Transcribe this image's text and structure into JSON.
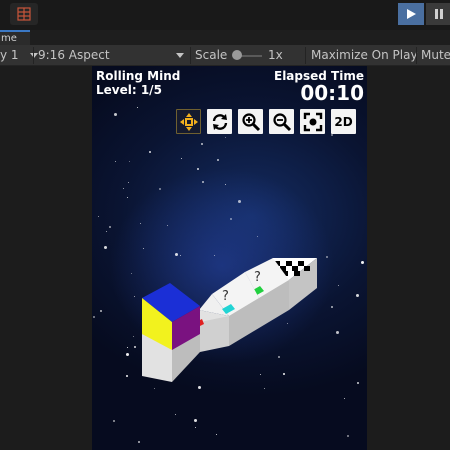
{
  "editor": {
    "tab_label": "me",
    "display_label": "y 1",
    "aspect_label": "9:16 Aspect",
    "scale_label": "Scale",
    "scale_value": "1x",
    "maximize_label": "Maximize On Play",
    "mute_label": "Mute"
  },
  "hud": {
    "game_title": "Rolling Mind",
    "level": "Level: 1/5",
    "elapsed_label": "Elapsed Time",
    "elapsed_time": "00:10"
  },
  "camera_buttons": [
    {
      "icon": "move-arrows-icon",
      "active": true
    },
    {
      "icon": "rotate-icon"
    },
    {
      "icon": "zoom-in-icon"
    },
    {
      "icon": "zoom-out-icon"
    },
    {
      "icon": "focus-frame-icon"
    },
    {
      "label": "2D"
    }
  ],
  "board": {
    "tiles": [
      {
        "kind": "start",
        "marker_color": "#e02020"
      },
      {
        "kind": "mystery",
        "text": "?",
        "marker_color": "#22d4d4"
      },
      {
        "kind": "mystery",
        "text": "?",
        "marker_color": "#22d040"
      },
      {
        "kind": "goal",
        "pattern": "checkered"
      }
    ],
    "cube_colors": {
      "top": "#1b2fd6",
      "left": "#f2f21e",
      "right": "#7a1280"
    }
  },
  "colors": {
    "accent_play": "#4a6fa0",
    "tab_underline": "#3b78c4",
    "space_background": "#0a1432"
  }
}
